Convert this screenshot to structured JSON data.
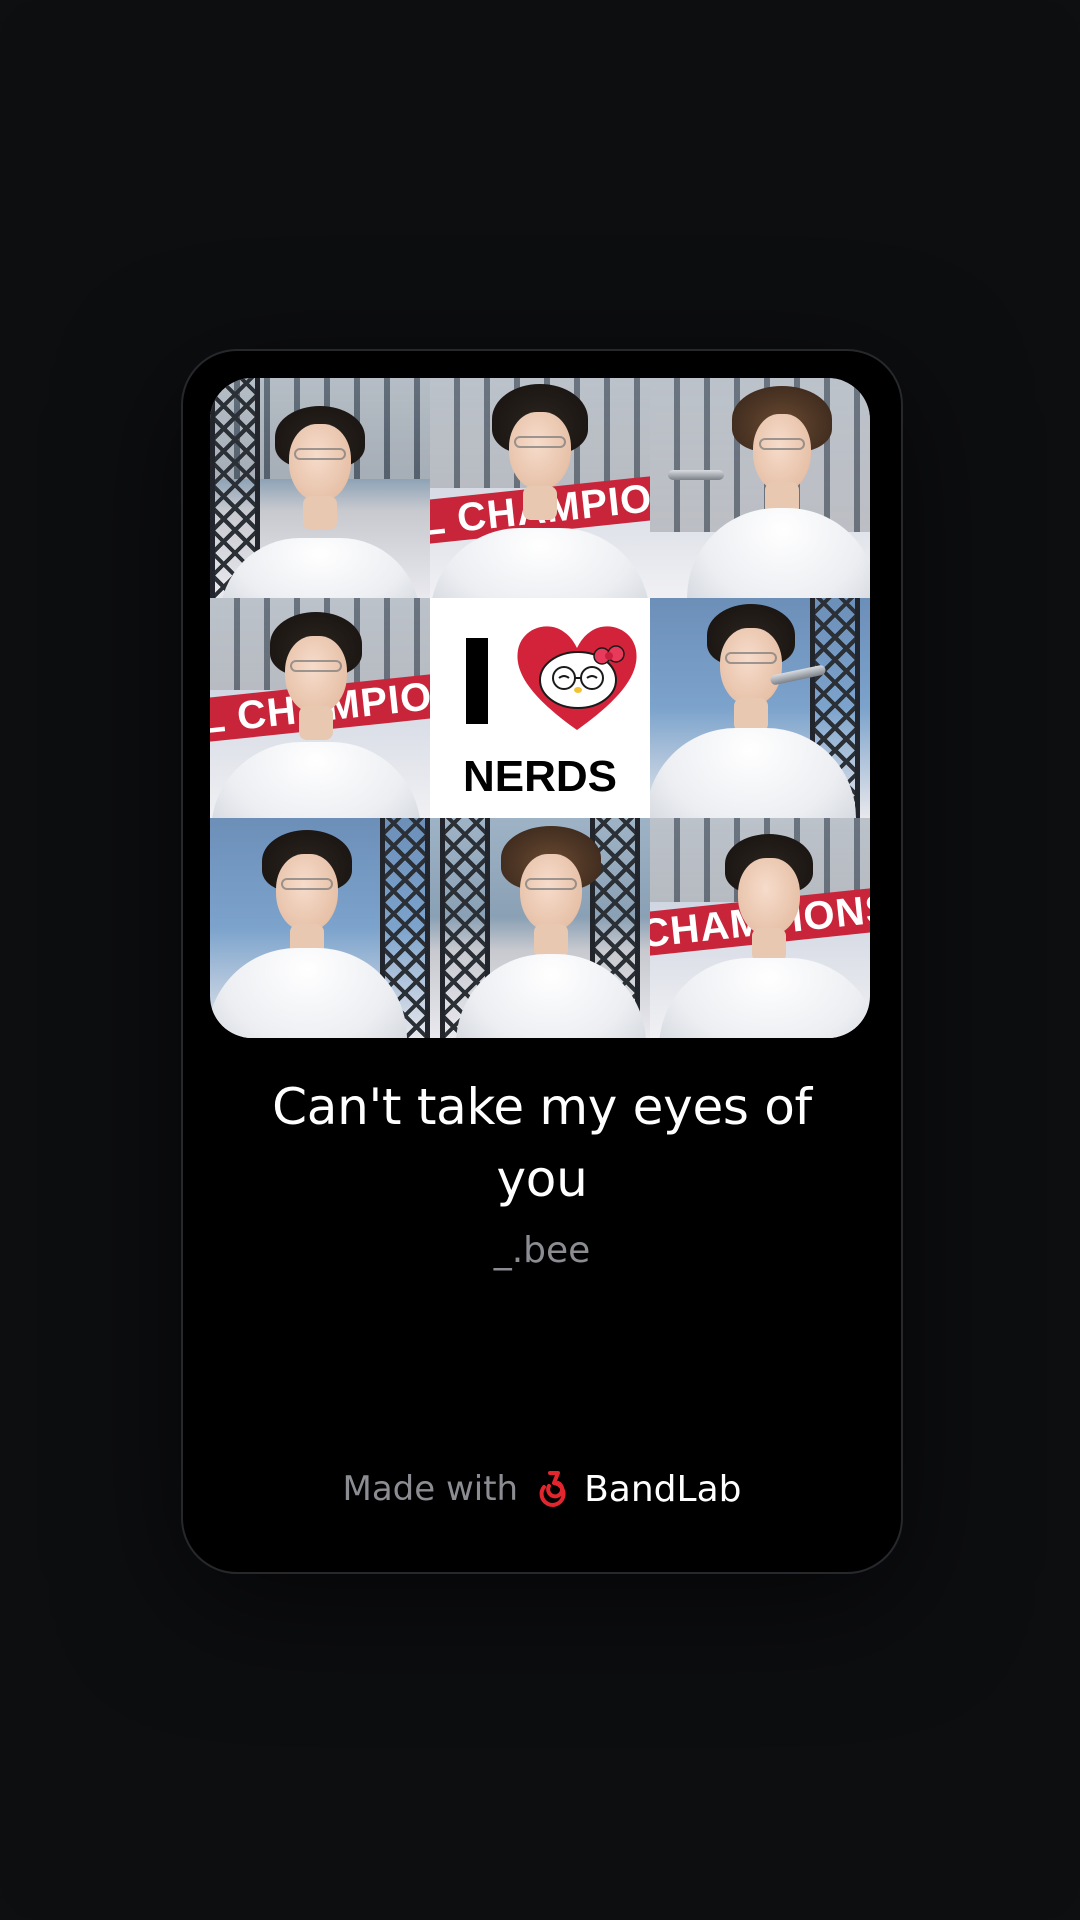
{
  "track": {
    "title": "Can't take my eyes of you",
    "artist": "_.bee"
  },
  "artwork": {
    "center_letter": "I",
    "center_caption": "NERDS",
    "banner_texts": [
      "L CHAMPIO",
      "L CHAMPION",
      "CHAMPIONS"
    ],
    "heart_color": "#d3233a"
  },
  "footer": {
    "made_with": "Made with",
    "brand_name": "BandLab",
    "brand_color": "#e3262e",
    "logo_icon": "bandlab-logo-icon"
  },
  "colors": {
    "background": "#0d0e10",
    "card": "#000000",
    "title": "#ffffff",
    "muted": "#8b8d92"
  }
}
